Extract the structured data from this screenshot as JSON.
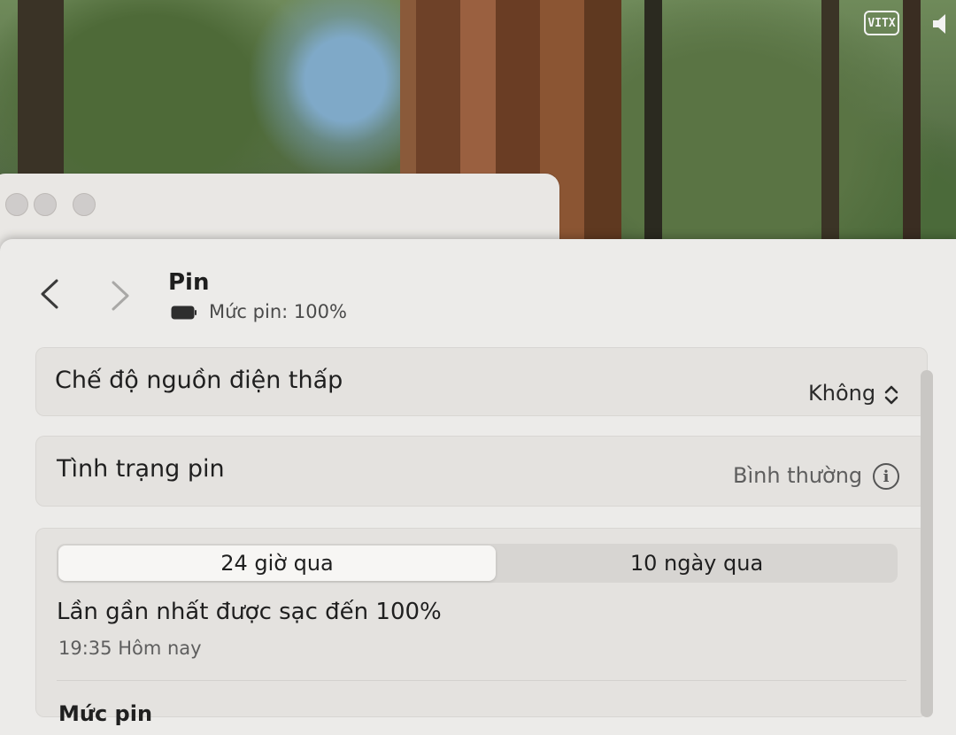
{
  "menubar": {
    "widget_label": "VITX",
    "volume_icon": "speaker-icon"
  },
  "header": {
    "title": "Pin",
    "battery_icon": "battery-icon",
    "battery_level_text": "Mức pin: 100%"
  },
  "settings": {
    "low_power_mode": {
      "label": "Chế độ nguồn điện thấp",
      "value": "Không"
    },
    "battery_health": {
      "label": "Tình trạng pin",
      "value": "Bình thường"
    }
  },
  "usage": {
    "tabs": [
      {
        "label": "24 giờ qua",
        "selected": true
      },
      {
        "label": "10 ngày qua",
        "selected": false
      }
    ],
    "last_charged_title": "Lần gần nhất được sạc đến 100%",
    "last_charged_time": "19:35 Hôm nay",
    "section_heading": "Mức pin"
  },
  "colors": {
    "window_bg": "#ecebe9",
    "card_bg": "#e4e2df",
    "text_primary": "#1f1f1f",
    "text_secondary": "#5e5e5e"
  }
}
